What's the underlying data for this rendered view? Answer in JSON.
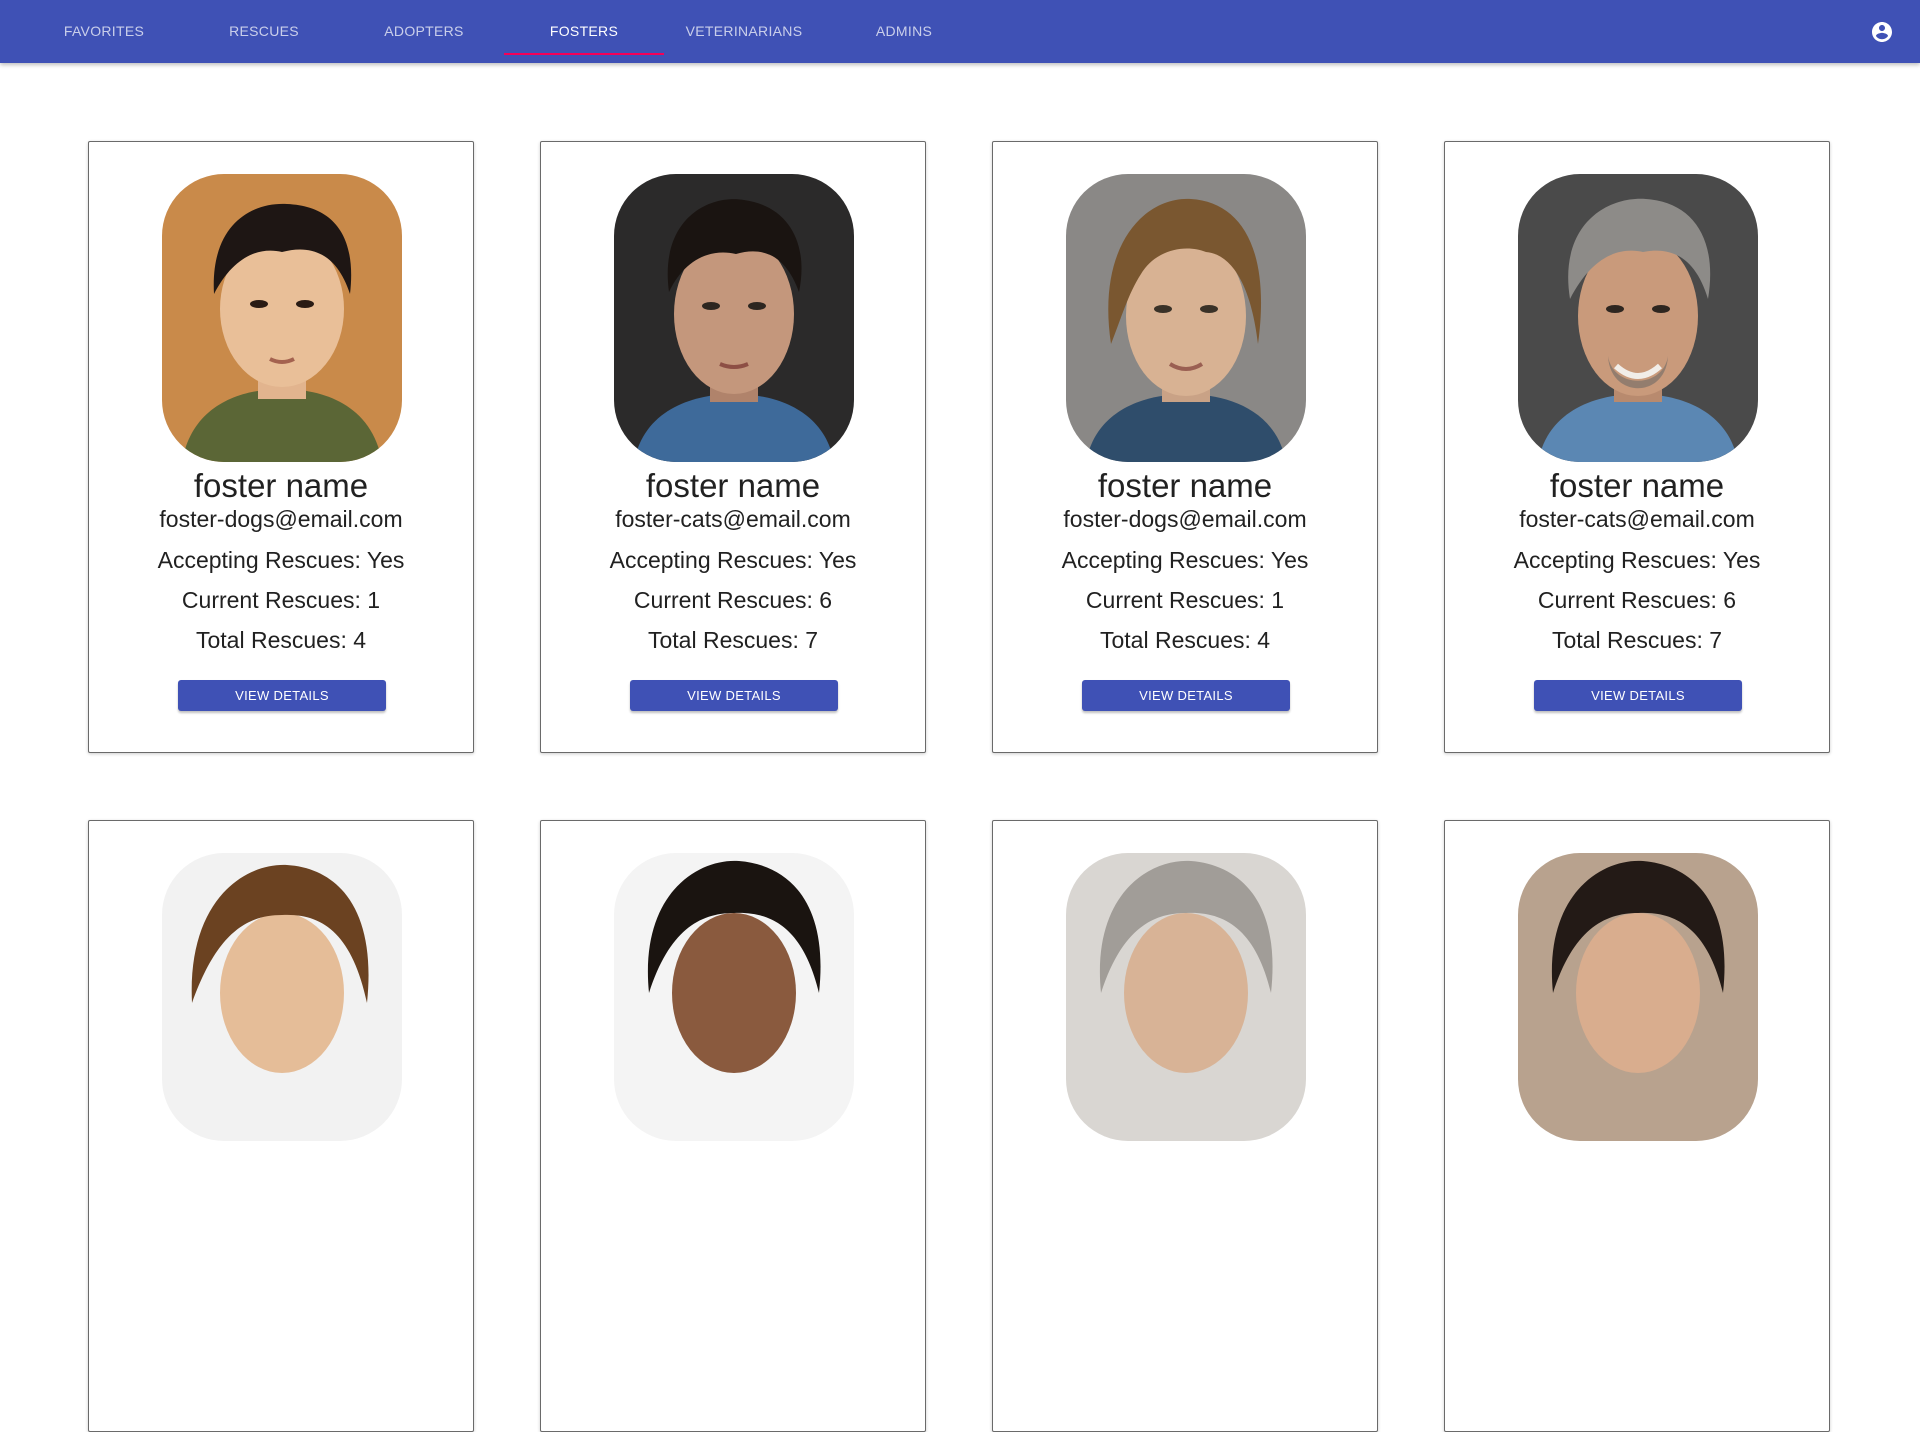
{
  "nav": {
    "tabs": [
      {
        "label": "FAVORITES"
      },
      {
        "label": "RESCUES"
      },
      {
        "label": "ADOPTERS"
      },
      {
        "label": "FOSTERS"
      },
      {
        "label": "VETERINARIANS"
      },
      {
        "label": "ADMINS"
      }
    ],
    "active_tab": "FOSTERS",
    "account_icon": "account-circle-icon"
  },
  "colors": {
    "primary": "#3f51b5",
    "indicator": "#f50057",
    "text": "#212121"
  },
  "fosters": [
    {
      "name": "foster name",
      "email": "foster-dogs@email.com",
      "accepting": "Accepting Rescues: Yes",
      "current": "Current Rescues: 1",
      "total": "Total Rescues: 4",
      "button": "VIEW DETAILS"
    },
    {
      "name": "foster name",
      "email": "foster-cats@email.com",
      "accepting": "Accepting Rescues: Yes",
      "current": "Current Rescues: 6",
      "total": "Total Rescues: 7",
      "button": "VIEW DETAILS"
    },
    {
      "name": "foster name",
      "email": "foster-dogs@email.com",
      "accepting": "Accepting Rescues: Yes",
      "current": "Current Rescues: 1",
      "total": "Total Rescues: 4",
      "button": "VIEW DETAILS"
    },
    {
      "name": "foster name",
      "email": "foster-cats@email.com",
      "accepting": "Accepting Rescues: Yes",
      "current": "Current Rescues: 6",
      "total": "Total Rescues: 7",
      "button": "VIEW DETAILS"
    }
  ]
}
